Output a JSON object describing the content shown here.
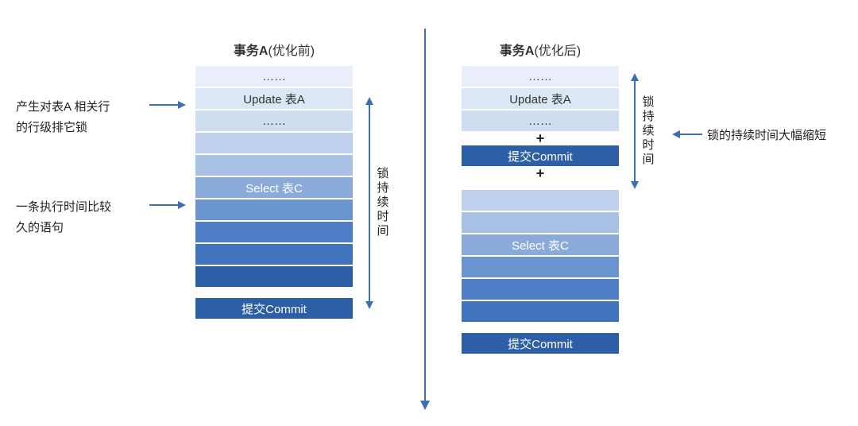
{
  "left": {
    "title_bold": "事务A",
    "title_light": "(优化前)",
    "rows": [
      "……",
      "Update 表A",
      "……",
      "",
      "",
      "Select 表C",
      "",
      "",
      "",
      ""
    ],
    "commit": "提交Commit"
  },
  "right": {
    "title_bold": "事务A",
    "title_light": "(优化后)",
    "group1_rows": [
      "……",
      "Update 表A",
      "……"
    ],
    "group1_commit": "提交Commit",
    "plus": "+",
    "group2_rows": [
      "",
      "",
      "Select 表C",
      "",
      "",
      ""
    ],
    "group2_commit": "提交Commit"
  },
  "annotations": {
    "left1": "产生对表A 相关行\n的行级排它锁",
    "left2": "一条执行时间比较\n久的语句",
    "right1": "锁的持续时间大幅缩短",
    "lock_span": "锁持续时间"
  }
}
